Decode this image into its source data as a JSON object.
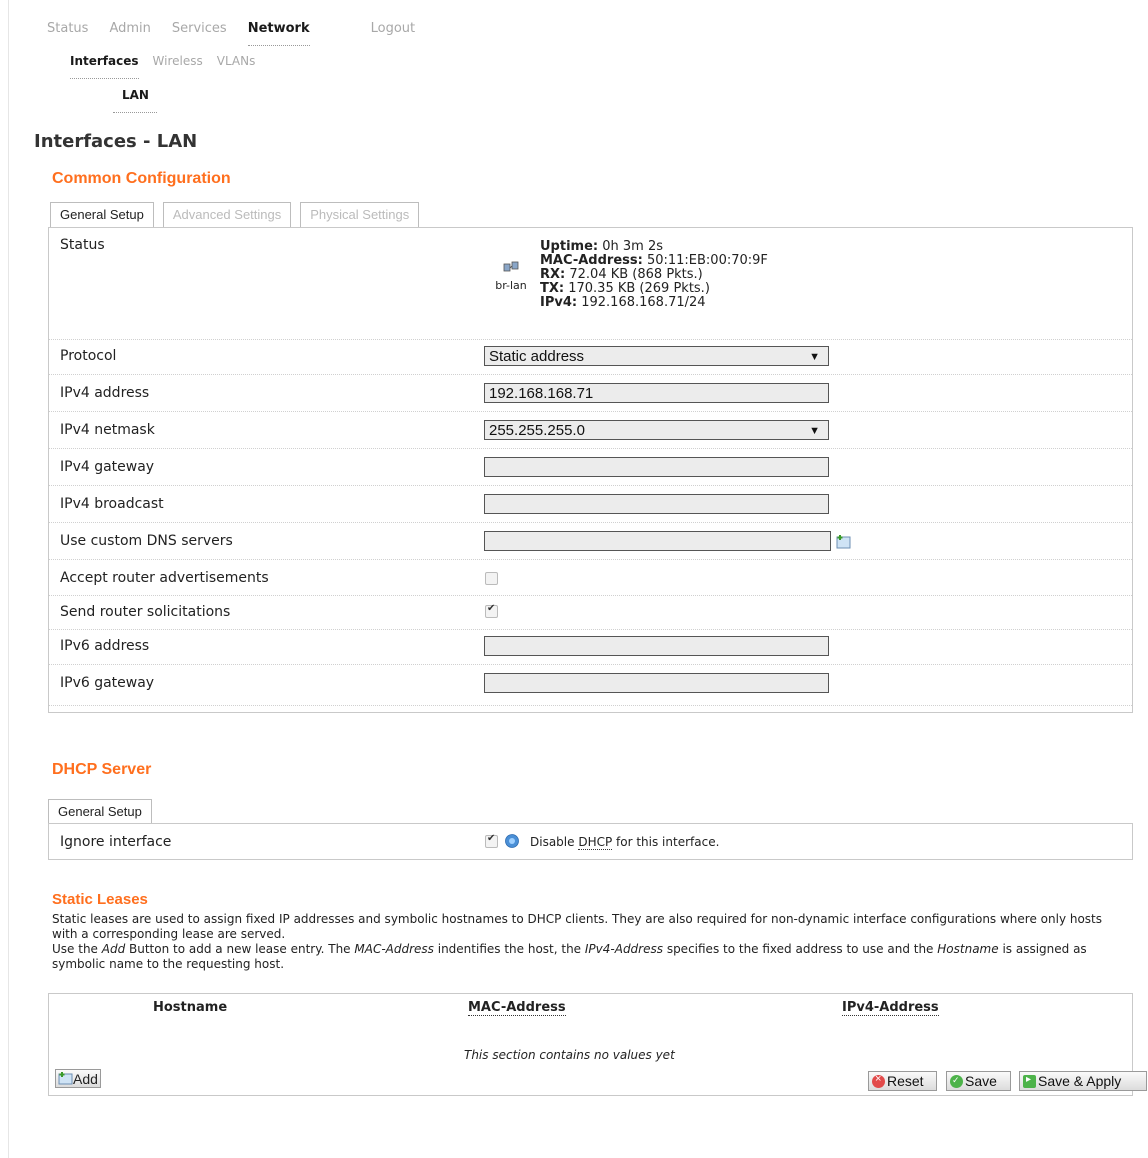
{
  "nav": {
    "top": [
      "Status",
      "Admin",
      "Services",
      "Network",
      "Logout"
    ],
    "sub": [
      "Interfaces",
      "Wireless",
      "VLANs"
    ],
    "sub2": "LAN"
  },
  "page_title": "Interfaces - LAN",
  "common": {
    "title": "Common Configuration",
    "tabs": [
      "General Setup",
      "Advanced Settings",
      "Physical Settings"
    ],
    "status": {
      "label": "Status",
      "device": "br-lan",
      "uptime_label": "Uptime:",
      "uptime": "0h 3m 2s",
      "mac_label": "MAC-Address:",
      "mac": "50:11:EB:00:70:9F",
      "rx_label": "RX:",
      "rx": "72.04 KB (868 Pkts.)",
      "tx_label": "TX:",
      "tx": "170.35 KB (269 Pkts.)",
      "ipv4_label": "IPv4:",
      "ipv4": "192.168.168.71/24"
    },
    "fields": {
      "protocol_label": "Protocol",
      "protocol_value": "Static address",
      "ipv4_address_label": "IPv4 address",
      "ipv4_address_value": "192.168.168.71",
      "ipv4_netmask_label": "IPv4 netmask",
      "ipv4_netmask_value": "255.255.255.0",
      "ipv4_gateway_label": "IPv4 gateway",
      "ipv4_gateway_value": "",
      "ipv4_broadcast_label": "IPv4 broadcast",
      "ipv4_broadcast_value": "",
      "dns_label": "Use custom DNS servers",
      "dns_value": "",
      "accept_ra_label": "Accept router advertisements",
      "accept_ra_checked": false,
      "send_rs_label": "Send router solicitations",
      "send_rs_checked": true,
      "ipv6_address_label": "IPv6 address",
      "ipv6_address_value": "",
      "ipv6_gateway_label": "IPv6 gateway",
      "ipv6_gateway_value": ""
    }
  },
  "dhcp": {
    "title": "DHCP Server",
    "tab": "General Setup",
    "ignore_label": "Ignore interface",
    "ignore_checked": true,
    "ignore_desc_prefix": "Disable ",
    "ignore_desc_abbr": "DHCP",
    "ignore_desc_suffix": " for this interface."
  },
  "leases": {
    "title": "Static Leases",
    "desc1": "Static leases are used to assign fixed IP addresses and symbolic hostnames to DHCP clients. They are also required for non-dynamic interface configurations where only hosts with a corresponding lease are served.",
    "desc2_a": "Use the ",
    "desc2_add": "Add",
    "desc2_b": " Button to add a new lease entry. The ",
    "desc2_mac": "MAC-Address",
    "desc2_c": " indentifies the host, the ",
    "desc2_ipv4": "IPv4-Address",
    "desc2_d": " specifies to the fixed address to use and the ",
    "desc2_host": "Hostname",
    "desc2_e": " is assigned as symbolic name to the requesting host.",
    "columns": [
      "Hostname",
      "MAC-Address",
      "IPv4-Address"
    ],
    "empty": "This section contains no values yet",
    "add_label": "Add"
  },
  "buttons": {
    "reset": "Reset",
    "save": "Save",
    "apply": "Save & Apply"
  }
}
